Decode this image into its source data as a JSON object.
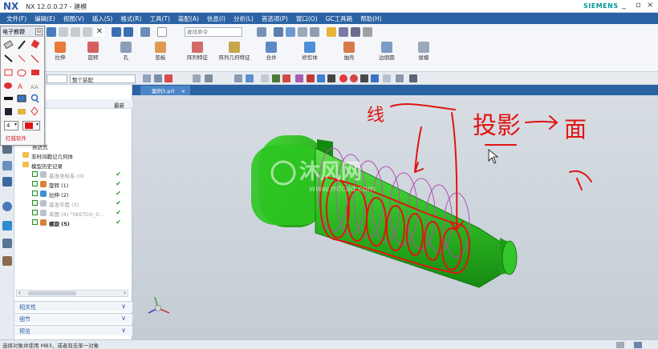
{
  "window": {
    "logo": "NX",
    "title": "NX 12.0.0.27 - 建模",
    "brand": "SIEMENS"
  },
  "menu": [
    "文件(F)",
    "编辑(E)",
    "视图(V)",
    "插入(S)",
    "格式(R)",
    "工具(T)",
    "装配(A)",
    "信息(I)",
    "分析(L)",
    "首选项(P)",
    "窗口(O)",
    "GC工具箱",
    "帮助(H)"
  ],
  "quick_access": {
    "search_placeholder": "查找命令"
  },
  "ribbon": {
    "buttons": [
      "拉伸",
      "旋转",
      "孔",
      "筋板",
      "阵列特征",
      "阵列几何特征",
      "合并",
      "修剪体",
      "抽壳",
      "边倒圆",
      "拔模"
    ]
  },
  "selection_bar": {
    "filter": "",
    "scope": "整个装配"
  },
  "document_tab": {
    "name": "案例3.prt",
    "close": "×"
  },
  "navigator": {
    "latest_header": "最新",
    "rows": [
      {
        "label": "视图",
        "indent": 2,
        "type": "none",
        "dim": false,
        "check": false
      },
      {
        "label": "像机",
        "indent": 2,
        "type": "none",
        "dim": false,
        "check": false
      },
      {
        "label": "纸",
        "indent": 2,
        "type": "none",
        "dim": false,
        "check": false
      },
      {
        "label": "表达式",
        "indent": 2,
        "type": "none",
        "dim": false,
        "check": false
      },
      {
        "label": "非时间戳记几何体",
        "indent": 1,
        "type": "folder",
        "dim": false,
        "check": false
      },
      {
        "label": "模型历史记录",
        "indent": 1,
        "type": "folder",
        "dim": false,
        "check": false
      },
      {
        "label": "基准坐标系 (0)",
        "indent": 2,
        "type": "feature",
        "dim": true,
        "check": true
      },
      {
        "label": "旋转 (1)",
        "indent": 2,
        "type": "feature",
        "dim": false,
        "check": true
      },
      {
        "label": "拉伸 (2)",
        "indent": 2,
        "type": "feature",
        "dim": false,
        "check": true
      },
      {
        "label": "基准平面 (3)",
        "indent": 2,
        "type": "feature",
        "dim": true,
        "check": true
      },
      {
        "label": "草图 (4) \"SKETCH_0...",
        "indent": 2,
        "type": "feature",
        "dim": true,
        "check": true
      },
      {
        "label": "螺旋 (5)",
        "indent": 2,
        "type": "feature",
        "dim": false,
        "check": true,
        "bold": true
      }
    ],
    "panels": [
      "相关性",
      "细节",
      "预览"
    ]
  },
  "palette": {
    "title": "电子教鞭",
    "line_width": "4",
    "footer": "红蜡软件"
  },
  "annotations": {
    "text_xian": "线",
    "text_touying": "投影",
    "arrow": "→",
    "text_mian": "面"
  },
  "watermark": {
    "brand": "沐风网",
    "url": "www.mfcad.com"
  },
  "status": "选择对象并使用 MB3，或者双击某一对象",
  "colors": {
    "menu": "#2a62a3",
    "model_green": "#2fbf24",
    "sketch_red": "#e11414",
    "helix": "#b44fb4"
  }
}
